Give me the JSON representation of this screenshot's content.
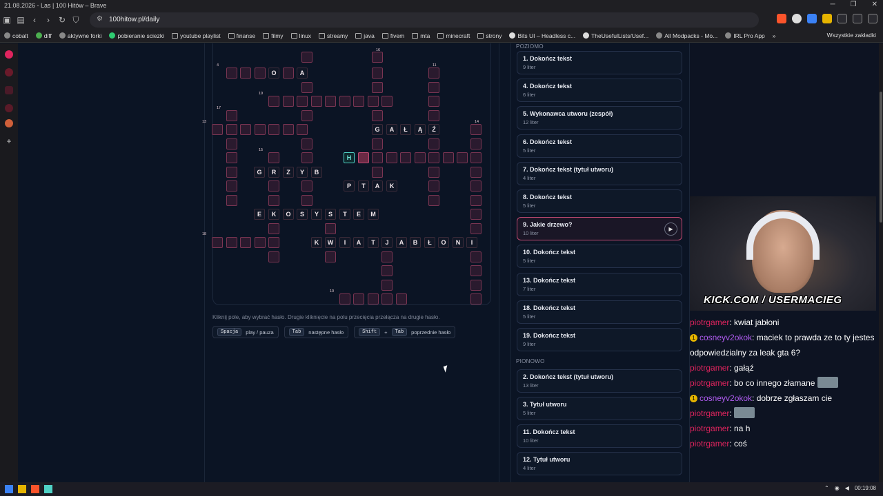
{
  "window": {
    "title": "21.08.2026 - Las | 100 Hitów – Brave"
  },
  "browser": {
    "url": "100hitow.pl/daily"
  },
  "bookmarks": [
    "cobalt",
    "diff",
    "aktywne forki",
    "pobieranie sciezki",
    "youtube playlist",
    "finanse",
    "filmy",
    "linux",
    "streamy",
    "java",
    "fivem",
    "mta",
    "minecraft",
    "strony",
    "Bits UI – Headless c...",
    "TheUsefulLists/Usef...",
    "All Modpacks - Mo...",
    "IRL Pro App"
  ],
  "bookmarks_more": "»",
  "bookmarks_other": "Wszystkie zakładki",
  "crossword": {
    "cells": [
      [
        436,
        12,
        "",
        0
      ],
      [
        538,
        12,
        "",
        0
      ],
      [
        327,
        35,
        "",
        0
      ],
      [
        347,
        35,
        "",
        0
      ],
      [
        368,
        35,
        "",
        0
      ],
      [
        388,
        35,
        "O",
        1
      ],
      [
        409,
        35,
        "",
        0
      ],
      [
        429,
        35,
        "A",
        1
      ],
      [
        538,
        35,
        "",
        0
      ],
      [
        620,
        35,
        "",
        0
      ],
      [
        436,
        56,
        "",
        0
      ],
      [
        538,
        56,
        "",
        0
      ],
      [
        620,
        56,
        "",
        0
      ],
      [
        388,
        76,
        "",
        0
      ],
      [
        409,
        76,
        "",
        0
      ],
      [
        429,
        76,
        "",
        0
      ],
      [
        450,
        76,
        "",
        0
      ],
      [
        470,
        76,
        "",
        0
      ],
      [
        491,
        76,
        "",
        0
      ],
      [
        511,
        76,
        "",
        0
      ],
      [
        532,
        76,
        "",
        0
      ],
      [
        552,
        76,
        "",
        0
      ],
      [
        620,
        76,
        "",
        0
      ],
      [
        327,
        97,
        "",
        0
      ],
      [
        436,
        97,
        "",
        0
      ],
      [
        538,
        97,
        "",
        0
      ],
      [
        620,
        97,
        "",
        0
      ],
      [
        306,
        117,
        "",
        0
      ],
      [
        327,
        117,
        "",
        0
      ],
      [
        347,
        117,
        "",
        0
      ],
      [
        368,
        117,
        "",
        0
      ],
      [
        388,
        117,
        "",
        0
      ],
      [
        409,
        117,
        "",
        0
      ],
      [
        429,
        117,
        "",
        0
      ],
      [
        538,
        117,
        "G",
        1
      ],
      [
        559,
        117,
        "A",
        1
      ],
      [
        579,
        117,
        "Ł",
        1
      ],
      [
        600,
        117,
        "Ą",
        1
      ],
      [
        620,
        117,
        "Ź",
        1
      ],
      [
        681,
        117,
        "",
        0
      ],
      [
        327,
        138,
        "",
        0
      ],
      [
        436,
        138,
        "",
        0
      ],
      [
        538,
        138,
        "",
        0
      ],
      [
        620,
        138,
        "",
        0
      ],
      [
        681,
        138,
        "",
        0
      ],
      [
        327,
        158,
        "",
        0
      ],
      [
        388,
        158,
        "",
        0
      ],
      [
        436,
        158,
        "",
        0
      ],
      [
        497,
        158,
        "H",
        2
      ],
      [
        518,
        158,
        "",
        3
      ],
      [
        538,
        158,
        "",
        0
      ],
      [
        559,
        158,
        "",
        0
      ],
      [
        579,
        158,
        "",
        0
      ],
      [
        600,
        158,
        "",
        0
      ],
      [
        620,
        158,
        "",
        0
      ],
      [
        641,
        158,
        "",
        0
      ],
      [
        661,
        158,
        "",
        0
      ],
      [
        681,
        158,
        "",
        0
      ],
      [
        327,
        179,
        "",
        0
      ],
      [
        367,
        179,
        "G",
        1
      ],
      [
        388,
        179,
        "R",
        1
      ],
      [
        409,
        179,
        "Z",
        1
      ],
      [
        429,
        179,
        "Y",
        1
      ],
      [
        450,
        179,
        "B",
        1
      ],
      [
        538,
        179,
        "",
        0
      ],
      [
        620,
        179,
        "",
        0
      ],
      [
        681,
        179,
        "",
        0
      ],
      [
        327,
        199,
        "",
        0
      ],
      [
        388,
        199,
        "",
        0
      ],
      [
        436,
        199,
        "",
        0
      ],
      [
        497,
        199,
        "P",
        1
      ],
      [
        518,
        199,
        "T",
        1
      ],
      [
        538,
        199,
        "A",
        1
      ],
      [
        559,
        199,
        "K",
        1
      ],
      [
        620,
        199,
        "",
        0
      ],
      [
        681,
        199,
        "",
        0
      ],
      [
        327,
        220,
        "",
        0
      ],
      [
        388,
        220,
        "",
        0
      ],
      [
        436,
        220,
        "",
        0
      ],
      [
        620,
        220,
        "",
        0
      ],
      [
        681,
        220,
        "",
        0
      ],
      [
        367,
        240,
        "E",
        1
      ],
      [
        388,
        240,
        "K",
        1
      ],
      [
        409,
        240,
        "O",
        1
      ],
      [
        429,
        240,
        "S",
        1
      ],
      [
        450,
        240,
        "Y",
        1
      ],
      [
        470,
        240,
        "S",
        1
      ],
      [
        491,
        240,
        "T",
        1
      ],
      [
        511,
        240,
        "E",
        1
      ],
      [
        532,
        240,
        "M",
        1
      ],
      [
        681,
        240,
        "",
        0
      ],
      [
        388,
        261,
        "",
        0
      ],
      [
        470,
        261,
        "",
        0
      ],
      [
        681,
        261,
        "",
        0
      ],
      [
        306,
        281,
        "",
        0
      ],
      [
        327,
        281,
        "",
        0
      ],
      [
        347,
        281,
        "",
        0
      ],
      [
        368,
        281,
        "",
        0
      ],
      [
        388,
        281,
        "",
        0
      ],
      [
        450,
        281,
        "K",
        1
      ],
      [
        470,
        281,
        "W",
        1
      ],
      [
        491,
        281,
        "I",
        1
      ],
      [
        511,
        281,
        "A",
        1
      ],
      [
        532,
        281,
        "T",
        1
      ],
      [
        552,
        281,
        "J",
        1
      ],
      [
        573,
        281,
        "A",
        1
      ],
      [
        593,
        281,
        "B",
        1
      ],
      [
        614,
        281,
        "Ł",
        1
      ],
      [
        634,
        281,
        "O",
        1
      ],
      [
        655,
        281,
        "N",
        1
      ],
      [
        675,
        281,
        "I",
        1
      ],
      [
        388,
        302,
        "",
        0
      ],
      [
        470,
        302,
        "",
        0
      ],
      [
        552,
        302,
        "",
        0
      ],
      [
        681,
        302,
        "",
        0
      ],
      [
        552,
        322,
        "",
        0
      ],
      [
        681,
        322,
        "",
        0
      ],
      [
        552,
        343,
        "",
        0
      ],
      [
        681,
        343,
        "",
        0
      ],
      [
        491,
        363,
        "",
        0
      ],
      [
        511,
        363,
        "",
        0
      ],
      [
        532,
        363,
        "",
        0
      ],
      [
        552,
        363,
        "",
        0
      ],
      [
        573,
        363,
        "",
        0
      ],
      [
        681,
        363,
        "",
        0
      ]
    ],
    "numbers": [
      [
        "16",
        544,
        7
      ],
      [
        "4",
        313,
        29
      ],
      [
        "11",
        626,
        29
      ],
      [
        "19",
        374,
        70
      ],
      [
        "17",
        313,
        91
      ],
      [
        "13",
        292,
        111
      ],
      [
        "14",
        687,
        111
      ],
      [
        "15",
        374,
        152
      ],
      [
        "18",
        292,
        274
      ],
      [
        "10",
        477,
        357
      ]
    ],
    "hint": "Kliknij pole, aby wybrać hasło. Drugie kliknięcie na polu przecięcia przełącza na drugie hasło.",
    "keys": {
      "space": "Spacja",
      "space_label": "play / pauza",
      "tab": "Tab",
      "tab_label": "następne hasło",
      "shift": "Shift",
      "plus": "+",
      "tab2": "Tab",
      "prev_label": "poprzednie hasło"
    }
  },
  "clues": {
    "poziomo_label": "POZIOMO",
    "pionowo_label": "PIONOWO",
    "poziomo": [
      {
        "title": "1. Dokończ tekst",
        "sub": "9 liter"
      },
      {
        "title": "4. Dokończ tekst",
        "sub": "6 liter"
      },
      {
        "title": "5. Wykonawca utworu (zespół)",
        "sub": "12 liter"
      },
      {
        "title": "6. Dokończ tekst",
        "sub": "5 liter"
      },
      {
        "title": "7. Dokończ tekst (tytuł utworu)",
        "sub": "4 liter"
      },
      {
        "title": "8. Dokończ tekst",
        "sub": "5 liter"
      },
      {
        "title": "9. Jakie drzewo?",
        "sub": "10 liter",
        "active": true
      },
      {
        "title": "10. Dokończ tekst",
        "sub": "5 liter"
      },
      {
        "title": "13. Dokończ tekst",
        "sub": "7 liter"
      },
      {
        "title": "18. Dokończ tekst",
        "sub": "5 liter"
      },
      {
        "title": "19. Dokończ tekst",
        "sub": "9 liter"
      }
    ],
    "pionowo": [
      {
        "title": "2. Dokończ tekst (tytuł utworu)",
        "sub": "13 liter"
      },
      {
        "title": "3. Tytuł utworu",
        "sub": "5 liter"
      },
      {
        "title": "11. Dokończ tekst",
        "sub": "10 liter"
      },
      {
        "title": "12. Tytuł utworu",
        "sub": "4 liter"
      }
    ]
  },
  "stream": {
    "overlay": "KICK.COM / USERMACIEG",
    "chat": [
      {
        "user": "piotrgamer",
        "msg": ": kwiat jabłoni",
        "badge": false
      },
      {
        "user": "cosneyv2okok",
        "msg": ": maciek to prawda ze to ty jestes odpowiedzialny za leak gta 6?",
        "badge": true
      },
      {
        "user": "piotrgamer",
        "msg": ": gałąź",
        "badge": false
      },
      {
        "user": "piotrgamer",
        "msg": ": bo co innego złamane",
        "badge": false,
        "emote": true
      },
      {
        "user": "cosneyv2okok",
        "msg": ": dobrze zgłaszam cie",
        "badge": true
      },
      {
        "user": "piotrgamer",
        "msg": ":",
        "badge": false,
        "emote": true
      },
      {
        "user": "piotrgamer",
        "msg": ": na h",
        "badge": false
      },
      {
        "user": "piotrgamer",
        "msg": ": coś",
        "badge": false
      }
    ]
  },
  "taskbar": {
    "time": "00:19:08"
  },
  "colors": {
    "accent": "#c04a72",
    "active_cell": "#4fd1c5",
    "chat_user": "#e0245e",
    "chat_user2": "#b05cf0"
  }
}
